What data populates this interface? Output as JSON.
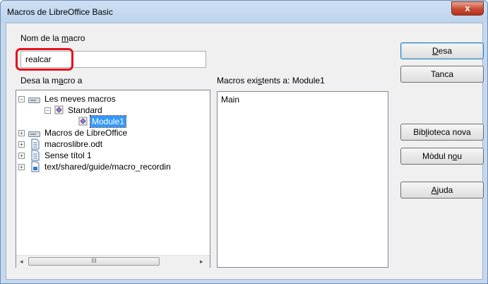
{
  "window": {
    "title": "Macros de LibreOffice Basic",
    "close_glyph": "x"
  },
  "macro_name": {
    "label_prefix": "Nom de la ",
    "label_access": "m",
    "label_suffix": "acro",
    "value": "realcar"
  },
  "save_in": {
    "label_prefix": "Desa la m",
    "label_access": "a",
    "label_suffix": "cro a"
  },
  "tree": [
    {
      "label": "Les meves macros",
      "expander": "−",
      "icon": "library-drive-icon"
    },
    {
      "label": "Standard",
      "expander": "−",
      "icon": "basic-library-icon"
    },
    {
      "label": "Module1",
      "expander": "",
      "icon": "basic-module-icon",
      "selected": true
    },
    {
      "label": "Macros de LibreOffice",
      "expander": "+",
      "icon": "library-drive-icon"
    },
    {
      "label": "macroslibre.odt",
      "expander": "+",
      "icon": "document-icon"
    },
    {
      "label": "Sense títol 1",
      "expander": "+",
      "icon": "document-icon"
    },
    {
      "label": "text/shared/guide/macro_recordin",
      "expander": "+",
      "icon": "document-icon"
    }
  ],
  "existing": {
    "label_prefix": "Macros exi",
    "label_access": "s",
    "label_suffix": "tents a: Module1",
    "items": [
      "Main"
    ]
  },
  "buttons": {
    "save": {
      "prefix": "",
      "access": "D",
      "suffix": "esa"
    },
    "close": {
      "label": "Tanca"
    },
    "new_library": {
      "prefix": "Bib",
      "access": "l",
      "suffix": "ioteca nova"
    },
    "new_module": {
      "prefix": "Mòdul n",
      "access": "o",
      "suffix": "u"
    },
    "help": {
      "prefix": "",
      "access": "A",
      "suffix": "juda"
    }
  },
  "scrollbar": {
    "left_arrow": "◂",
    "right_arrow": "▸",
    "grip": "III"
  },
  "colors": {
    "highlight_border": "#e3101c",
    "selection": "#3399ff",
    "close_button": "#c74a33"
  }
}
